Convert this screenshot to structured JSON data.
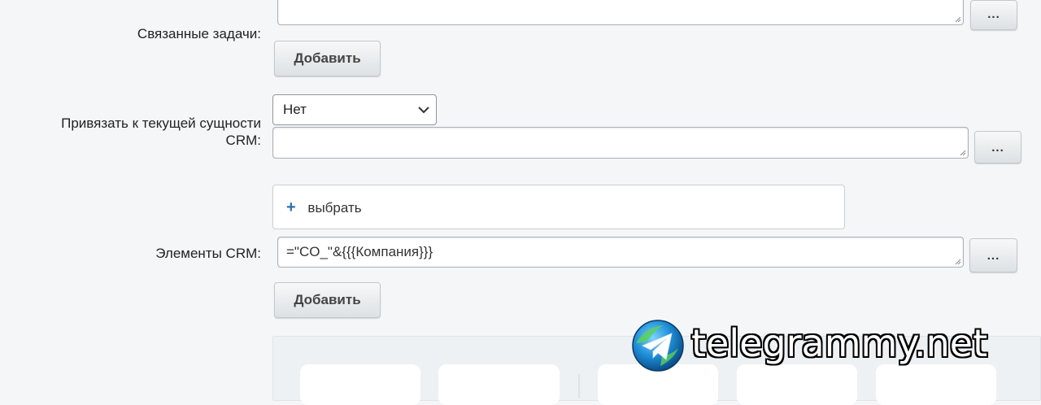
{
  "related_tasks": {
    "label": "Связанные задачи:",
    "more_button": "...",
    "add_button": "Добавить"
  },
  "bind_crm": {
    "label_line1": "Привязать к текущей сущности",
    "label_line2": "CRM:",
    "select_value": "Нет",
    "textarea_value": "",
    "more_button": "..."
  },
  "crm_elements": {
    "picker_plus": "+",
    "picker_label": "выбрать",
    "label": "Элементы CRM:",
    "textarea_value": "=\"CO_\"&{{{Компания}}}",
    "more_button": "...",
    "add_button": "Добавить"
  },
  "watermark": {
    "text": "telegrammy.net",
    "icon": "telegram-logo-icon"
  }
}
